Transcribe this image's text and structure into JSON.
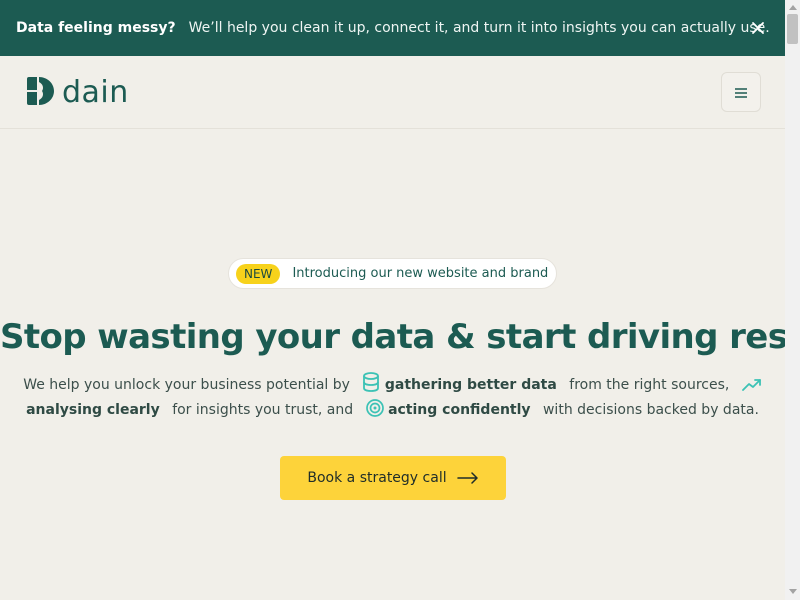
{
  "announcement": {
    "lead": "Data feeling messy?",
    "message": "We’ll help you clean it up, connect it, and turn it into insights you can actually use.",
    "close_icon": "close-icon"
  },
  "header": {
    "logo_text": "dain",
    "logo_icon": "dain-logo-mark",
    "menu_icon": "hamburger-menu-icon"
  },
  "hero": {
    "badge": "NEW",
    "pill_text": "Introducing our new website and brand",
    "title": "Stop wasting your data & start driving results",
    "line1": {
      "prefix": "We help you unlock your business potential by",
      "highlight1": "gathering better data",
      "middle": "from the right sources,"
    },
    "line2": {
      "highlight2": "analysing clearly",
      "middle": "for insights you trust, and",
      "highlight3": "acting confidently",
      "suffix": "with decisions backed by data."
    },
    "icons": [
      "database-icon",
      "trending-up-icon",
      "target-icon"
    ],
    "cta_label": "Book a strategy call",
    "cta_icon": "arrow-right-icon"
  },
  "colors": {
    "brand_green": "#1c5b52",
    "accent_yellow": "#fdd33a",
    "teal_icon": "#3cc2b5",
    "background": "#f1efe9"
  }
}
